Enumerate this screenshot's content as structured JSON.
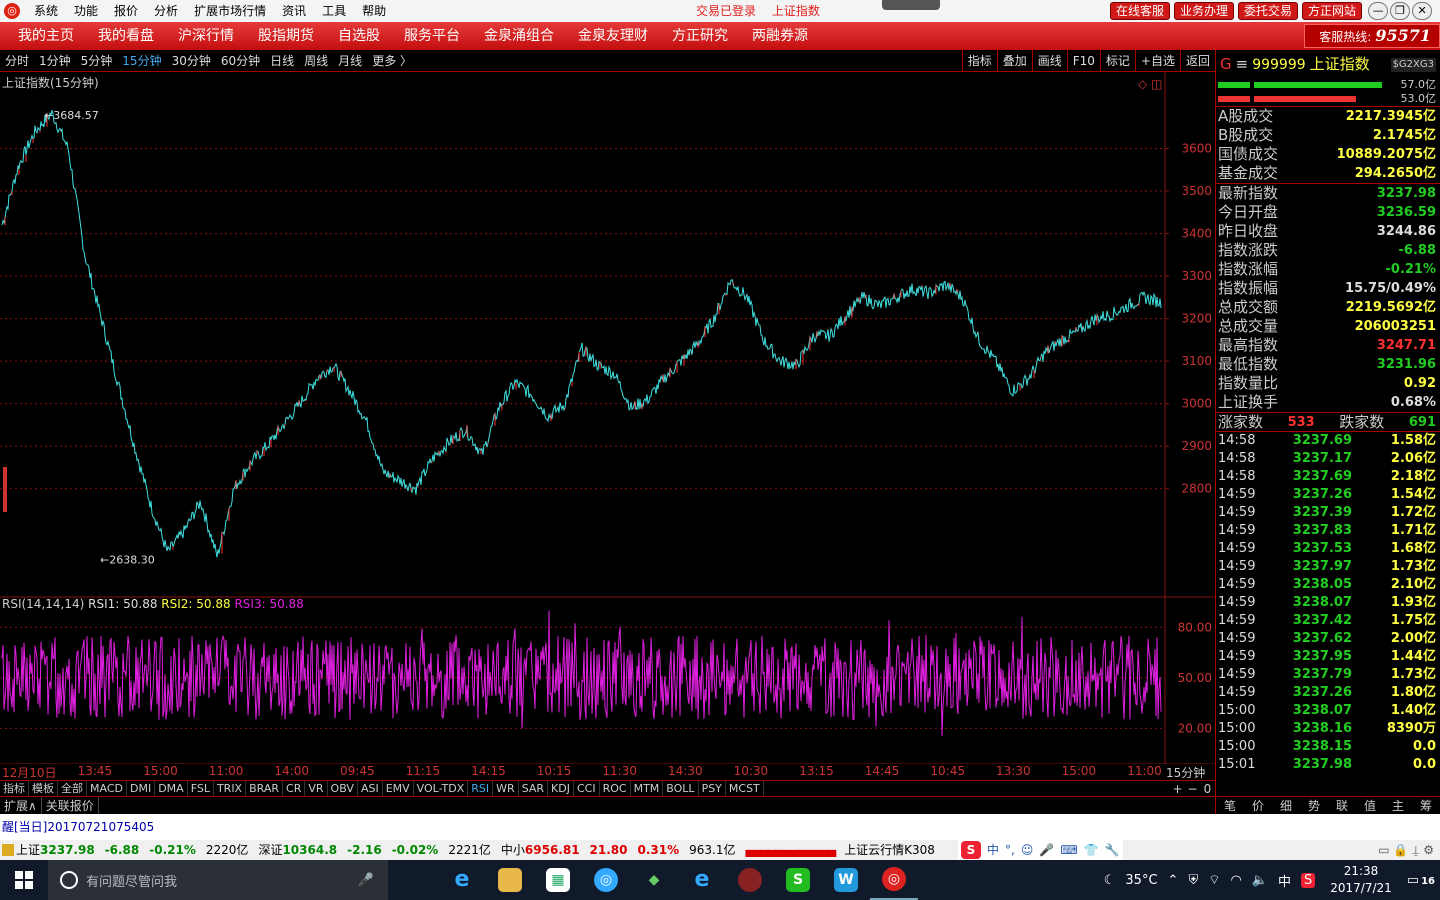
{
  "menubar": {
    "items": [
      "系统",
      "功能",
      "报价",
      "分析",
      "扩展市场行情",
      "资讯",
      "工具",
      "帮助"
    ],
    "status": [
      "交易已登录",
      "上证指数"
    ],
    "buttons": [
      "在线客服",
      "业务办理",
      "委托交易",
      "方正网站"
    ]
  },
  "navbar": {
    "items": [
      "我的主页",
      "我的看盘",
      "沪深行情",
      "股指期货",
      "自选股",
      "服务平台",
      "金泉涌组合",
      "金泉友理财",
      "方正研究",
      "两融券源"
    ],
    "hotline_label": "客服热线:",
    "hotline_number": "95571"
  },
  "periods": {
    "items": [
      "分时",
      "1分钟",
      "5分钟",
      "15分钟",
      "30分钟",
      "60分钟",
      "日线",
      "周线",
      "月线",
      "更多 〉"
    ],
    "active": "15分钟",
    "tools": [
      "指标",
      "叠加",
      "画线",
      "F10",
      "标记",
      "+自选",
      "返回"
    ]
  },
  "chart": {
    "title": "上证指数(15分钟)",
    "high_label": "3684.57",
    "low_label": "2638.30",
    "y_ticks": [
      "3600",
      "3500",
      "3400",
      "3300",
      "3200",
      "3100",
      "3000",
      "2900",
      "2800"
    ],
    "rsi_legend": {
      "name": "RSI(14,14,14)",
      "r1": "RSI1: 50.88",
      "r2": "RSI2: 50.88",
      "r3": "RSI3: 50.88"
    },
    "rsi_ticks": [
      "80.00",
      "50.00",
      "20.00"
    ],
    "x_ticks": [
      "12月10日",
      "13:45",
      "15:00",
      "11:00",
      "14:00",
      "09:45",
      "11:15",
      "14:15",
      "10:15",
      "11:30",
      "14:30",
      "10:30",
      "13:15",
      "14:45",
      "10:45",
      "13:30",
      "15:00",
      "11:00"
    ],
    "period_label": "15分钟",
    "colors": {
      "up": "#ff3030",
      "down": "#40e0e0",
      "rsi": "#e020e0",
      "grid": "#8a1010"
    }
  },
  "chart_data": {
    "type": "line",
    "title": "上证指数(15分钟)",
    "series": [
      {
        "values": [
          3420,
          3560,
          3640,
          3684,
          3600,
          3350,
          3200,
          3050,
          2900,
          2760,
          2650,
          2700,
          2770,
          2640,
          2800,
          2860,
          2900,
          2950,
          3000,
          3060,
          3090,
          3030,
          2960,
          2840,
          2820,
          2800,
          2870,
          2910,
          2940,
          2880,
          2990,
          3050,
          3020,
          2970,
          3000,
          3130,
          3090,
          3070,
          2990,
          3010,
          3060,
          3100,
          3140,
          3200,
          3290,
          3250,
          3150,
          3100,
          3090,
          3160,
          3160,
          3210,
          3250,
          3230,
          3250,
          3270,
          3260,
          3280,
          3250,
          3150,
          3100,
          3030,
          3060,
          3120,
          3150,
          3170,
          3200,
          3210,
          3230,
          3250,
          3238
        ]
      }
    ],
    "ylim": [
      2550,
      3780
    ]
  },
  "panel": {
    "index_code": "999999",
    "index_name": "上证指数",
    "tag": "$G2XG3",
    "bar1_pct": "57.0亿",
    "bar2_pct": "53.0亿",
    "turnover": [
      {
        "k": "A股成交",
        "v": "2217.3945亿"
      },
      {
        "k": "B股成交",
        "v": "2.1745亿"
      },
      {
        "k": "国债成交",
        "v": "10889.2075亿"
      },
      {
        "k": "基金成交",
        "v": "294.2650亿"
      }
    ],
    "stats": [
      {
        "k": "最新指数",
        "v": "3237.98",
        "c": "#2c2"
      },
      {
        "k": "今日开盘",
        "v": "3236.59",
        "c": "#2c2"
      },
      {
        "k": "昨日收盘",
        "v": "3244.86",
        "c": "#ddd"
      },
      {
        "k": "指数涨跌",
        "v": "-6.88",
        "c": "#2c2"
      },
      {
        "k": "指数涨幅",
        "v": "-0.21%",
        "c": "#2c2"
      },
      {
        "k": "指数振幅",
        "v": "15.75/0.49%",
        "c": "#ddd"
      },
      {
        "k": "总成交额",
        "v": "2219.5692亿",
        "c": "#ff4"
      },
      {
        "k": "总成交量",
        "v": "206003251",
        "c": "#ff4"
      },
      {
        "k": "最高指数",
        "v": "3247.71",
        "c": "#ff3030"
      },
      {
        "k": "最低指数",
        "v": "3231.96",
        "c": "#2c2"
      },
      {
        "k": "指数量比",
        "v": "0.92",
        "c": "#ff4"
      },
      {
        "k": "上证换手",
        "v": "0.68%",
        "c": "#ddd"
      }
    ],
    "up_label": "涨家数",
    "up_count": "533",
    "down_label": "跌家数",
    "down_count": "691",
    "ticks": [
      [
        "14:58",
        "3237.69",
        "1.58亿"
      ],
      [
        "14:58",
        "3237.17",
        "2.06亿"
      ],
      [
        "14:58",
        "3237.69",
        "2.18亿"
      ],
      [
        "14:59",
        "3237.26",
        "1.54亿"
      ],
      [
        "14:59",
        "3237.39",
        "1.72亿"
      ],
      [
        "14:59",
        "3237.83",
        "1.71亿"
      ],
      [
        "14:59",
        "3237.53",
        "1.68亿"
      ],
      [
        "14:59",
        "3237.97",
        "1.73亿"
      ],
      [
        "14:59",
        "3238.05",
        "2.10亿"
      ],
      [
        "14:59",
        "3238.07",
        "1.93亿"
      ],
      [
        "14:59",
        "3237.42",
        "1.75亿"
      ],
      [
        "14:59",
        "3237.62",
        "2.00亿"
      ],
      [
        "14:59",
        "3237.95",
        "1.44亿"
      ],
      [
        "14:59",
        "3237.79",
        "1.73亿"
      ],
      [
        "14:59",
        "3237.26",
        "1.80亿"
      ],
      [
        "15:00",
        "3238.07",
        "1.40亿"
      ],
      [
        "15:00",
        "3238.16",
        "8390万"
      ],
      [
        "15:00",
        "3238.15",
        "0.0"
      ],
      [
        "15:01",
        "3237.98",
        "0.0"
      ]
    ],
    "tabs": [
      "笔",
      "价",
      "细",
      "势",
      "联",
      "值",
      "主",
      "筹"
    ]
  },
  "indicators": {
    "items": [
      "指标",
      "模板",
      "全部",
      "MACD",
      "DMI",
      "DMA",
      "FSL",
      "TRIX",
      "BRAR",
      "CR",
      "VR",
      "OBV",
      "ASI",
      "EMV",
      "VOL-TDX",
      "RSI",
      "WR",
      "SAR",
      "KDJ",
      "CCI",
      "ROC",
      "MTM",
      "BOLL",
      "PSY",
      "MCST"
    ],
    "active": "RSI",
    "controls": [
      "+",
      "−",
      "0"
    ]
  },
  "extbar": [
    "扩展∧",
    "关联报价"
  ],
  "alert": "醒[当日]20170721075405",
  "statusbar": {
    "sh_name": "上证",
    "sh_val": "3237.98",
    "sh_chg": "-6.88",
    "sh_pct": "-0.21%",
    "sh_amt": "2220亿",
    "sz_name": "深证",
    "sz_val": "10364.8",
    "sz_chg": "-2.16",
    "sz_pct": "-0.02%",
    "sz_amt": "2221亿",
    "zx_name": "中小",
    "zx_val": "6956.81",
    "zx_chg": "21.80",
    "zx_pct": "0.31%",
    "zx_amt": "963.1亿",
    "cloud": "上证云行情K308",
    "ime": [
      "S",
      "中",
      "°,",
      "☺",
      "🎤",
      "⌨",
      "👕",
      "🔧"
    ]
  },
  "taskbar": {
    "search_placeholder": "有问题尽管问我",
    "temp": "35°C",
    "lang": "中",
    "time": "21:38",
    "date": "2017/7/21",
    "notif": "16"
  }
}
